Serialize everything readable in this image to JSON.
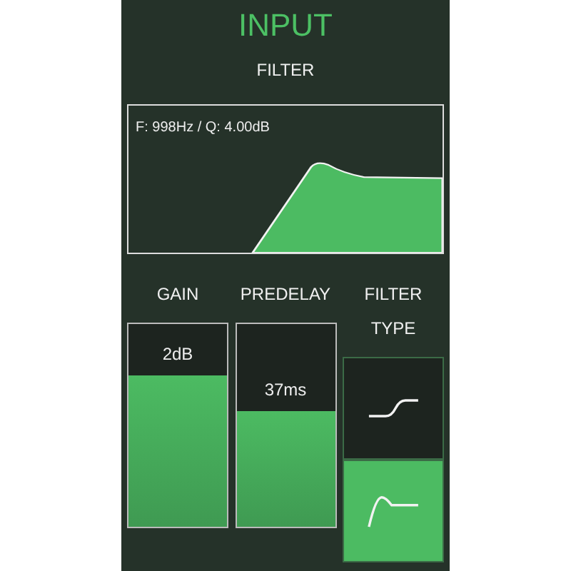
{
  "title": "INPUT",
  "filter": {
    "heading": "FILTER",
    "readout": "F: 998Hz / Q: 4.00dB"
  },
  "controls": [
    {
      "label": "GAIN",
      "value": "2dB",
      "level": 0.75
    },
    {
      "label": "PREDELAY",
      "value": "37ms",
      "level": 0.57
    }
  ],
  "filter_type": {
    "label": "FILTER TYPE",
    "options": [
      {
        "kind": "shelf",
        "selected": false
      },
      {
        "kind": "peak",
        "selected": true
      }
    ]
  }
}
